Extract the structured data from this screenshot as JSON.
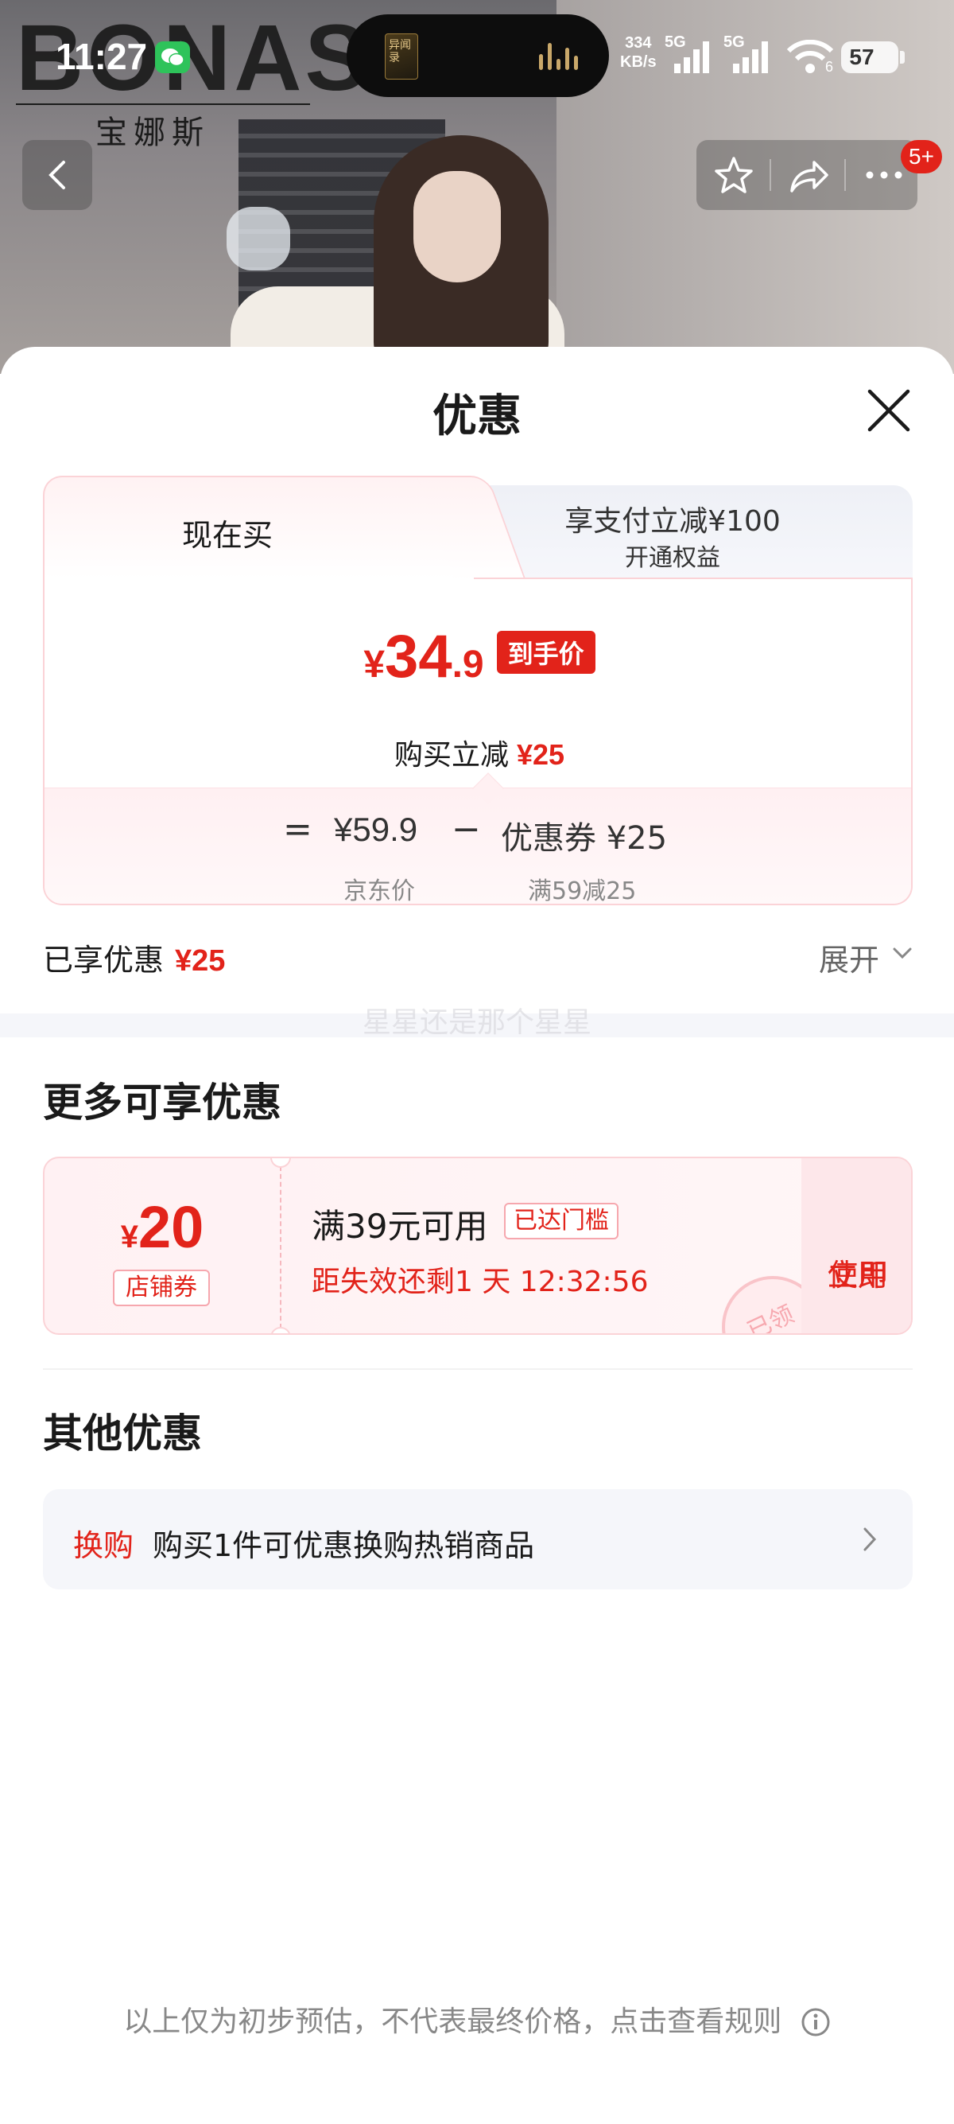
{
  "status_bar": {
    "time": "11:27",
    "net_speed_top": "334",
    "net_speed_unit": "KB/s",
    "signal1_label": "5G",
    "signal2_label": "5G",
    "wifi_sub": "6",
    "battery": "57",
    "island_cover_text": "异闻录"
  },
  "brand": {
    "latin": "BONAS",
    "chinese": "宝娜斯"
  },
  "nav": {
    "badge": "5+"
  },
  "sheet": {
    "title": "优惠",
    "tabs": {
      "now_label": "现在买",
      "pay_line1": "享支付立减¥100",
      "pay_line2": "开通权益"
    },
    "final_price": {
      "yen": "¥",
      "integer": "34",
      "decimal": ".9",
      "tag": "到手价"
    },
    "reduce": {
      "label": "购买立减",
      "amount": "¥25"
    },
    "breakdown": {
      "equals": "=",
      "jd_price": "¥59.9",
      "minus": "−",
      "coupon_value": "优惠券 ¥25",
      "jd_label": "京东价",
      "coupon_label": "满59减25"
    },
    "enjoyed": {
      "label": "已享优惠",
      "amount": "¥25"
    },
    "expand_label": "展开",
    "watermark": "星星还是那个星星",
    "more_title": "更多可享优惠",
    "coupon": {
      "yen": "¥",
      "value": "20",
      "type": "店铺券",
      "condition": "满39元可用",
      "reached_tag": "已达门槛",
      "expire": "距失效还剩1 天 12:32:56",
      "use_line1": "立即",
      "use_line2": "使用",
      "stamp": "已领"
    },
    "other_title": "其他优惠",
    "exchange": {
      "tag": "换购",
      "text": "购买1件可优惠换购热销商品"
    },
    "disclaimer": "以上仅为初步预估，不代表最终价格，点击查看规则"
  },
  "colors": {
    "accent": "#e2231a",
    "coupon_border": "#fbd3d7",
    "muted": "#888888"
  }
}
